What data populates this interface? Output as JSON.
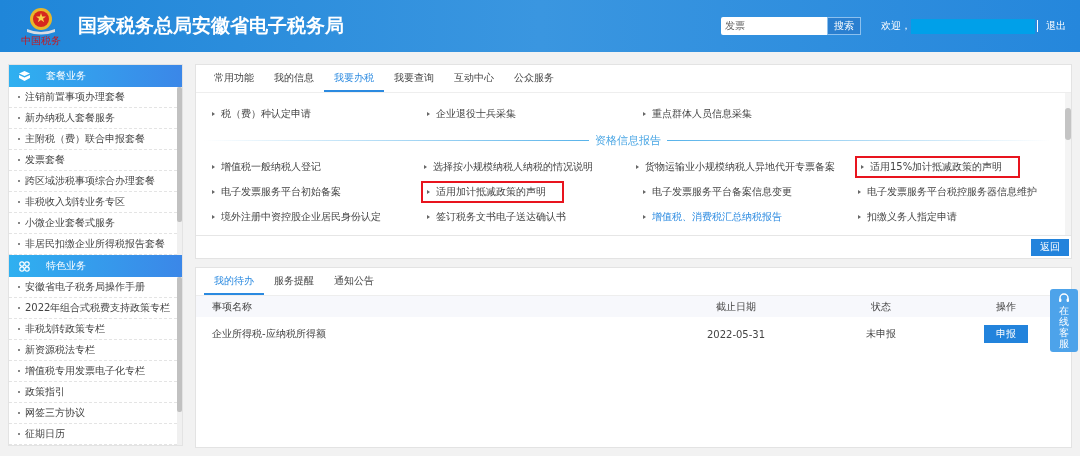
{
  "header": {
    "title": "国家税务总局安徽省电子税务局",
    "logo_caption": "中国税务",
    "search": {
      "value": "发票",
      "button": "搜索"
    },
    "welcome": "欢迎，",
    "logout": "退出"
  },
  "sidebar": {
    "groups": [
      {
        "title": "套餐业务",
        "items": [
          "注销前置事项办理套餐",
          "新办纳税人套餐服务",
          "主附税（费）联合申报套餐",
          "发票套餐",
          "跨区域涉税事项综合办理套餐",
          "非税收入划转业务专区",
          "小微企业套餐式服务",
          "非居民扣缴企业所得税报告套餐"
        ]
      },
      {
        "title": "特色业务",
        "items": [
          "安徽省电子税务局操作手册",
          "2022年组合式税费支持政策专栏",
          "非税划转政策专栏",
          "新资源税法专栏",
          "增值税专用发票电子化专栏",
          "政策指引",
          "网签三方协议",
          "征期日历"
        ]
      }
    ]
  },
  "main": {
    "tabs": [
      {
        "label": "常用功能",
        "selected": false
      },
      {
        "label": "我的信息",
        "selected": false
      },
      {
        "label": "我要办税",
        "selected": true
      },
      {
        "label": "我要查询",
        "selected": false
      },
      {
        "label": "互动中心",
        "selected": false
      },
      {
        "label": "公众服务",
        "selected": false
      }
    ],
    "top_rows": [
      [
        {
          "label": "税（费）种认定申请",
          "highlighted": false,
          "current": false
        },
        {
          "label": "企业退役士兵采集",
          "highlighted": false,
          "current": false
        },
        {
          "label": "重点群体人员信息采集",
          "highlighted": false,
          "current": false
        }
      ]
    ],
    "section_title": "资格信息报告",
    "rows": [
      [
        {
          "label": "增值税一般纳税人登记",
          "highlighted": false,
          "current": false
        },
        {
          "label": "选择按小规模纳税人纳税的情况说明",
          "highlighted": false,
          "current": false
        },
        {
          "label": "货物运输业小规模纳税人异地代开专票备案",
          "highlighted": false,
          "current": false
        },
        {
          "label": "适用15%加计抵减政策的声明",
          "highlighted": true,
          "current": false
        }
      ],
      [
        {
          "label": "电子发票服务平台初始备案",
          "highlighted": false,
          "current": false
        },
        {
          "label": "适用加计抵减政策的声明",
          "highlighted": true,
          "current": false
        },
        {
          "label": "电子发票服务平台备案信息变更",
          "highlighted": false,
          "current": false
        },
        {
          "label": "电子发票服务平台税控服务器信息维护",
          "highlighted": false,
          "current": false
        }
      ],
      [
        {
          "label": "境外注册中资控股企业居民身份认定",
          "highlighted": false,
          "current": false
        },
        {
          "label": "签订税务文书电子送达确认书",
          "highlighted": false,
          "current": false
        },
        {
          "label": "增值税、消费税汇总纳税报告",
          "highlighted": false,
          "current": true
        },
        {
          "label": "扣缴义务人指定申请",
          "highlighted": false,
          "current": false
        }
      ]
    ],
    "back_button": "返回"
  },
  "todo": {
    "tabs": [
      {
        "label": "我的待办",
        "selected": true
      },
      {
        "label": "服务提醒",
        "selected": false
      },
      {
        "label": "通知公告",
        "selected": false
      }
    ],
    "columns": [
      "事项名称",
      "截止日期",
      "状态",
      "操作"
    ],
    "rows": [
      {
        "name": "企业所得税-应纳税所得额",
        "deadline": "2022-05-31",
        "status": "未申报",
        "action": "申报"
      }
    ]
  },
  "support_widget": {
    "label": "在线客服"
  }
}
